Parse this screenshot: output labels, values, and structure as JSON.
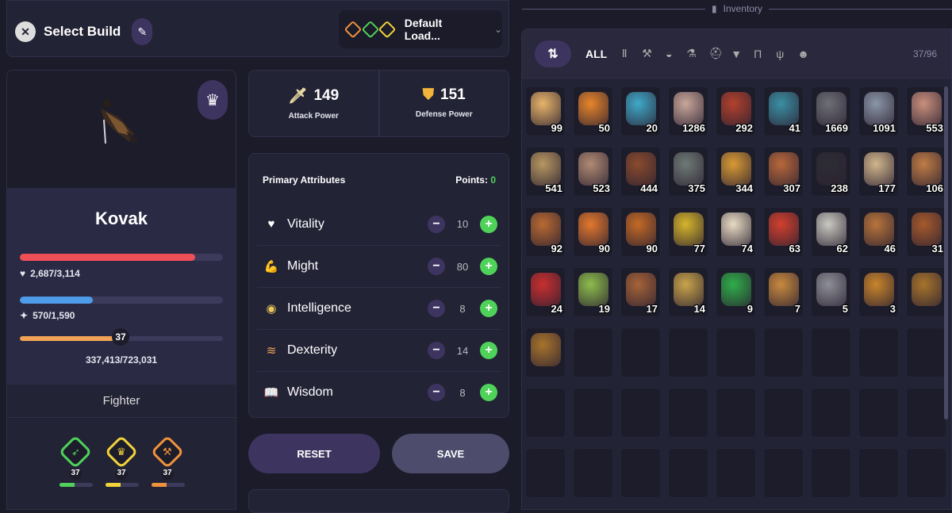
{
  "top_bar": {
    "select_build_label": "Select Build",
    "loadout_label": "Default Load...",
    "loadout_icon_colors": [
      "#f0923a",
      "#4fd25a",
      "#f2d23a"
    ]
  },
  "character": {
    "name": "Kovak",
    "class_name": "Fighter",
    "health": {
      "label": "2,687/3,114",
      "fraction": 0.863,
      "color": "#ef4f57"
    },
    "mana": {
      "label": "570/1,590",
      "fraction": 0.358,
      "color": "#4e9be8"
    },
    "xp": {
      "label": "337,413/723,031",
      "fraction": 0.466,
      "color": "#f2a356",
      "level": "37"
    },
    "classes": [
      {
        "level": "37",
        "color": "#4fd25a",
        "icon": "arrow-icon",
        "fill": 0.45
      },
      {
        "level": "37",
        "color": "#f2d23a",
        "icon": "crown-icon",
        "fill": 0.45
      },
      {
        "level": "37",
        "color": "#f0923a",
        "icon": "axe-icon",
        "fill": 0.45
      }
    ]
  },
  "power": {
    "attack_value": "149",
    "attack_label": "Attack Power",
    "defense_value": "151",
    "defense_label": "Defense Power"
  },
  "attributes": {
    "title": "Primary Attributes",
    "points_label": "Points:",
    "points_value": "0",
    "rows": [
      {
        "name": "Vitality",
        "value": "10",
        "icon": "heart-icon"
      },
      {
        "name": "Might",
        "value": "80",
        "icon": "muscle-icon"
      },
      {
        "name": "Intelligence",
        "value": "8",
        "icon": "eye-icon"
      },
      {
        "name": "Dexterity",
        "value": "14",
        "icon": "wing-icon"
      },
      {
        "name": "Wisdom",
        "value": "8",
        "icon": "book-icon"
      }
    ]
  },
  "buttons": {
    "reset": "RESET",
    "save": "SAVE"
  },
  "inventory": {
    "title": "Inventory",
    "filter_all": "ALL",
    "count": "37/96",
    "items": [
      {
        "qty": "99",
        "color": "#e7b469"
      },
      {
        "qty": "50",
        "color": "#e7852b"
      },
      {
        "qty": "20",
        "color": "#3fa9c9"
      },
      {
        "qty": "1286",
        "color": "#c9a79a"
      },
      {
        "qty": "292",
        "color": "#b2412d"
      },
      {
        "qty": "41",
        "color": "#3b8fa3"
      },
      {
        "qty": "1669",
        "color": "#6d6f76"
      },
      {
        "qty": "1091",
        "color": "#8a96a6"
      },
      {
        "qty": "553",
        "color": "#c98f7c"
      },
      {
        "qty": "541",
        "color": "#b79761"
      },
      {
        "qty": "523",
        "color": "#b08a73"
      },
      {
        "qty": "444",
        "color": "#8a4b2e"
      },
      {
        "qty": "375",
        "color": "#6e7a75"
      },
      {
        "qty": "344",
        "color": "#d99a35"
      },
      {
        "qty": "307",
        "color": "#b8683b"
      },
      {
        "qty": "238",
        "color": "#2d2d35"
      },
      {
        "qty": "177",
        "color": "#d1b68c"
      },
      {
        "qty": "106",
        "color": "#c07c45"
      },
      {
        "qty": "92",
        "color": "#b86a32"
      },
      {
        "qty": "90",
        "color": "#e3782e"
      },
      {
        "qty": "90",
        "color": "#c46a26"
      },
      {
        "qty": "77",
        "color": "#d6b52c"
      },
      {
        "qty": "74",
        "color": "#e8dcc3"
      },
      {
        "qty": "63",
        "color": "#d2402e"
      },
      {
        "qty": "62",
        "color": "#c9c9c0"
      },
      {
        "qty": "46",
        "color": "#b8743b"
      },
      {
        "qty": "31",
        "color": "#a65a2c"
      },
      {
        "qty": "24",
        "color": "#c92f2f"
      },
      {
        "qty": "19",
        "color": "#8dbd4c"
      },
      {
        "qty": "17",
        "color": "#a66338"
      },
      {
        "qty": "14",
        "color": "#c9a44b"
      },
      {
        "qty": "9",
        "color": "#2fae4a"
      },
      {
        "qty": "7",
        "color": "#c98a3f"
      },
      {
        "qty": "5",
        "color": "#8d8f98"
      },
      {
        "qty": "3",
        "color": "#c9852c"
      },
      {
        "qty": "",
        "color": "#a8742c"
      },
      {
        "qty": "",
        "color": "#a8742c"
      }
    ]
  }
}
